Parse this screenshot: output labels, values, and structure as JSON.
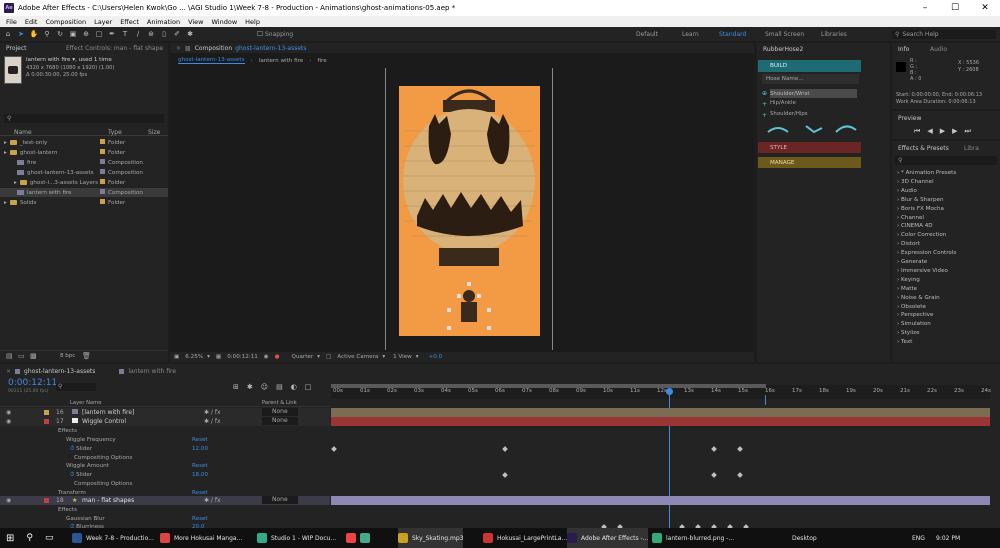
{
  "title_bar": {
    "text": "Adobe After Effects - C:\\Users\\Helen Kwok\\Go ... \\AGI Studio 1\\Week 7-8 - Production - Animations\\ghost-animations-05.aep *"
  },
  "menu": [
    "File",
    "Edit",
    "Composition",
    "Layer",
    "Effect",
    "Animation",
    "View",
    "Window",
    "Help"
  ],
  "toolbar": {
    "snapping": "Snapping",
    "search_placeholder": "Search Help"
  },
  "workspaces": [
    "Default",
    "Learn",
    "Standard",
    "Small Screen",
    "Libraries"
  ],
  "project": {
    "tab": "Project",
    "effect_controls_tab": "Effect Controls: man - flat shape",
    "selected_name": "lantern with fire ▾, used 1 time",
    "selected_info1": "4320 x 7680  (1080 x 1920) (1.00)",
    "selected_info2": "Δ 0:00:30:00, 25.00 fps",
    "col_name": "Name",
    "col_type": "Type",
    "col_size": "Size",
    "items": [
      {
        "name": "_test-only",
        "type": "Folder",
        "kind": "folder",
        "indent": 0
      },
      {
        "name": "ghost-lantern",
        "type": "Folder",
        "kind": "folder",
        "indent": 0
      },
      {
        "name": "fire",
        "type": "Composition",
        "kind": "comp",
        "indent": 1
      },
      {
        "name": "ghost-lantern-13-assets",
        "type": "Composition",
        "kind": "comp",
        "indent": 1
      },
      {
        "name": "ghost-l...3-assets Layers",
        "type": "Folder",
        "kind": "folder",
        "indent": 1
      },
      {
        "name": "lantern with fire",
        "type": "Composition",
        "kind": "comp",
        "indent": 1
      },
      {
        "name": "Solids",
        "type": "Folder",
        "kind": "folder",
        "indent": 0
      }
    ],
    "bpc": "8 bpc"
  },
  "composition": {
    "tab_label": "Composition",
    "tab_name": "ghost-lantern-13-assets",
    "flow": [
      "ghost-lantern-13-assets",
      "lantern with fire",
      "fire"
    ],
    "zoom": "6.25%",
    "timecode": "0:00:12:11",
    "resolution": "Quarter",
    "camera": "Active Camera",
    "views": "1 View",
    "exposure": "+0.0",
    "bg_color": "#f29a44"
  },
  "rubberhose": {
    "title": "RubberHose2",
    "build": "BUILD",
    "hose_name": "Hose Name...",
    "options": [
      "Shoulder/Wrist",
      "Hip/Ankle",
      "Shoulder/Hips"
    ],
    "style": "STYLE",
    "manage": "MANAGE"
  },
  "info": {
    "tab": "Info",
    "audio_tab": "Audio",
    "r": "R :",
    "g": "G :",
    "b": "B :",
    "a": "A :  0",
    "x": "X : 5536",
    "y": "Y : 2608",
    "start": "Start: 0:00:00:00, End: 0:00:06:13",
    "duration": "Work Area Duration: 0:00:06:13"
  },
  "preview": {
    "tab": "Preview"
  },
  "effects_presets": {
    "tab": "Effects & Presets",
    "library_tab": "Libra",
    "items": [
      "* Animation Presets",
      "3D Channel",
      "Audio",
      "Blur & Sharpen",
      "Boris FX Mocha",
      "Channel",
      "CINEMA 4D",
      "Color Correction",
      "Distort",
      "Expression Controls",
      "Generate",
      "Immersive Video",
      "Keying",
      "Matte",
      "Noise & Grain",
      "Obsolete",
      "Perspective",
      "Simulation",
      "Stylize",
      "Text"
    ]
  },
  "timeline": {
    "tab1": "ghost-lantern-13-assets",
    "tab2": "lantern with fire",
    "timecode": "0:00:12:11",
    "frame_info": "00311 (25.00 fps)",
    "col_layer_name": "Layer Name",
    "col_parent": "Parent & Link",
    "ruler": [
      "00s",
      "01s",
      "02s",
      "03s",
      "04s",
      "05s",
      "06s",
      "07s",
      "08s",
      "09s",
      "10s",
      "11s",
      "12s",
      "13s",
      "14s",
      "15s",
      "16s",
      "17s",
      "18s",
      "19s",
      "20s",
      "21s",
      "22s",
      "23s",
      "24s"
    ],
    "layers": [
      {
        "num": "16",
        "name": "[lantern with fire]",
        "parent": "None",
        "color": "#c9a24a"
      },
      {
        "num": "17",
        "name": "Wiggle Control",
        "parent": "None",
        "color": "#c04040"
      },
      {
        "num": "18",
        "name": "man - flat shapes",
        "parent": "None",
        "color": "#c04040"
      }
    ],
    "props": {
      "effects": "Effects",
      "wiggle_freq": "Wiggle Frequency",
      "reset": "Reset",
      "slider": "Slider",
      "freq_value": "12.00",
      "compositing": "Compositing Options",
      "wiggle_amount": "Wiggle Amount",
      "amount_value": "18.00",
      "transform": "Transform",
      "gaussian": "Gaussian Blur",
      "blurriness": "Blurriness",
      "blur_value": "20.0"
    }
  },
  "taskbar": {
    "items": [
      "Week 7-8 - Productio...",
      "More Hokusai Manga...",
      "Studio 1 - WIP Docu...",
      "Sky_Skating.mp3",
      "Hokusai_LargePrintLa...",
      "Adobe After Effects -...",
      "lantern-blurred.png -..."
    ],
    "desktop": "Desktop",
    "lang": "ENG",
    "time": "9:02 PM"
  }
}
